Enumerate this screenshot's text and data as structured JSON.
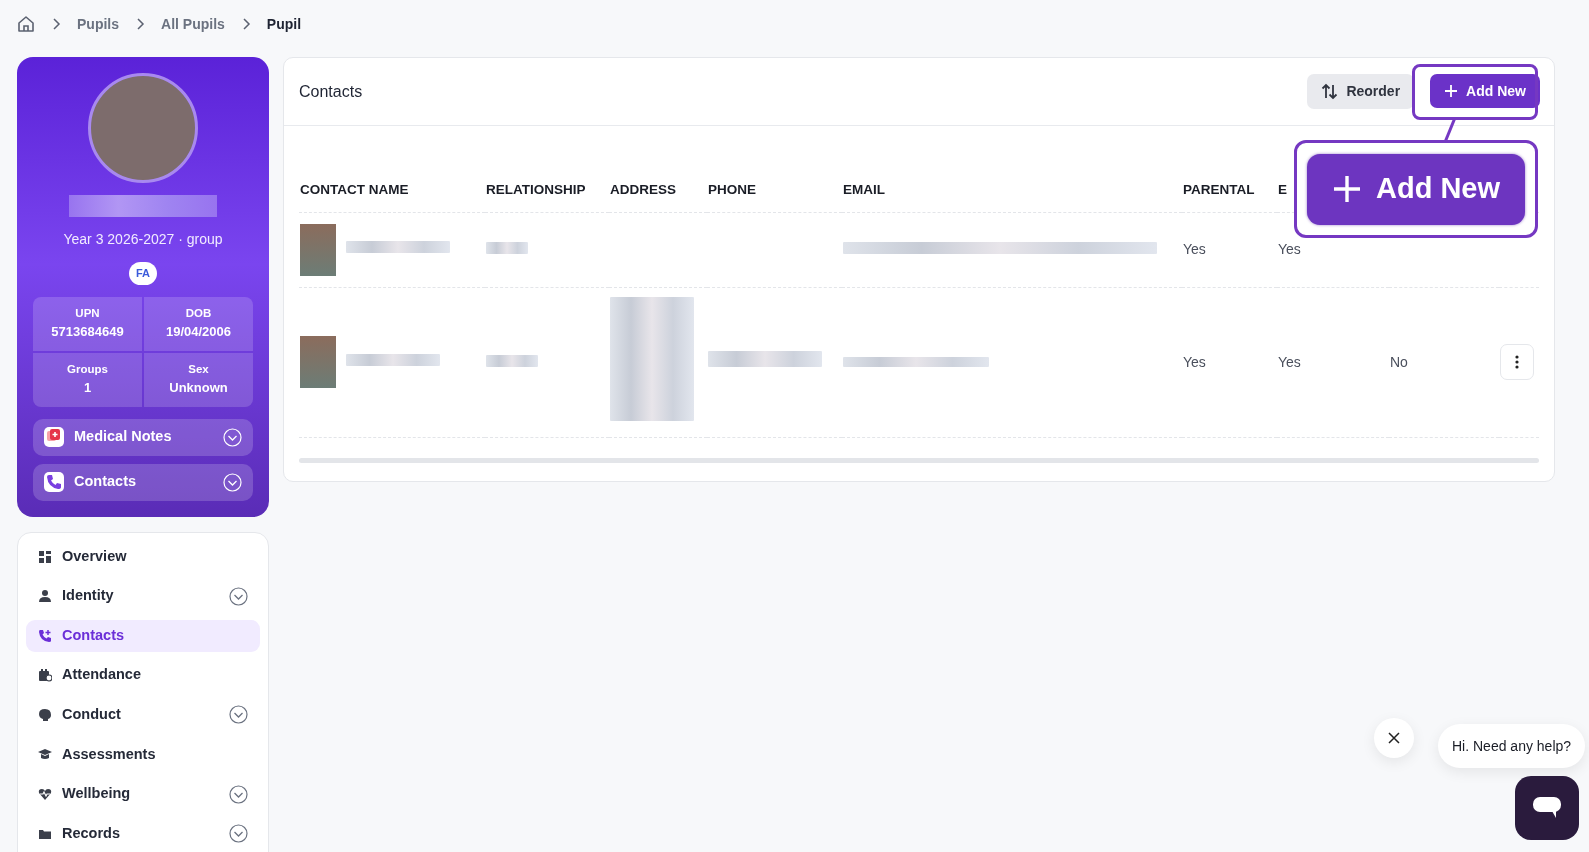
{
  "breadcrumb": [
    {
      "label": "Pupils",
      "selected": false
    },
    {
      "label": "All Pupils",
      "selected": false
    },
    {
      "label": "Pupil",
      "selected": true
    }
  ],
  "profile": {
    "group": "Year 3 2026-2027 · group",
    "badge": "FA",
    "stats": [
      {
        "label": "UPN",
        "value": "5713684649"
      },
      {
        "label": "DOB",
        "value": "19/04/2006"
      },
      {
        "label": "Groups",
        "value": "1"
      },
      {
        "label": "Sex",
        "value": "Unknown"
      }
    ],
    "sections": [
      {
        "label": "Medical Notes",
        "kind": "medical"
      },
      {
        "label": "Contacts",
        "kind": "phone"
      }
    ]
  },
  "nav": [
    {
      "label": "Overview",
      "kind": "grid",
      "expandable": false,
      "selected": false
    },
    {
      "label": "Identity",
      "kind": "person",
      "expandable": true,
      "selected": false
    },
    {
      "label": "Contacts",
      "kind": "phone",
      "expandable": false,
      "selected": true
    },
    {
      "label": "Attendance",
      "kind": "calendar",
      "expandable": false,
      "selected": false
    },
    {
      "label": "Conduct",
      "kind": "head",
      "expandable": true,
      "selected": false
    },
    {
      "label": "Assessments",
      "kind": "cap",
      "expandable": false,
      "selected": false
    },
    {
      "label": "Wellbeing",
      "kind": "heart",
      "expandable": true,
      "selected": false
    },
    {
      "label": "Records",
      "kind": "folder",
      "expandable": true,
      "selected": false
    }
  ],
  "contacts": {
    "title": "Contacts",
    "actions": [
      {
        "label": "Reorder",
        "kind": "reorder"
      },
      {
        "label": "Add New",
        "kind": "add"
      }
    ],
    "columns": [
      "CONTACT NAME",
      "RELATIONSHIP",
      "ADDRESS",
      "PHONE",
      "EMAIL",
      "PARENTAL",
      "E"
    ],
    "rows": [
      {
        "parental": "Yes",
        "column_7": "Yes"
      },
      {
        "parental": "Yes",
        "column_7": "Yes",
        "column_8": "No"
      }
    ]
  },
  "callout": {
    "label": "Add New"
  },
  "chat": {
    "message": "Hi. Need any help?"
  }
}
